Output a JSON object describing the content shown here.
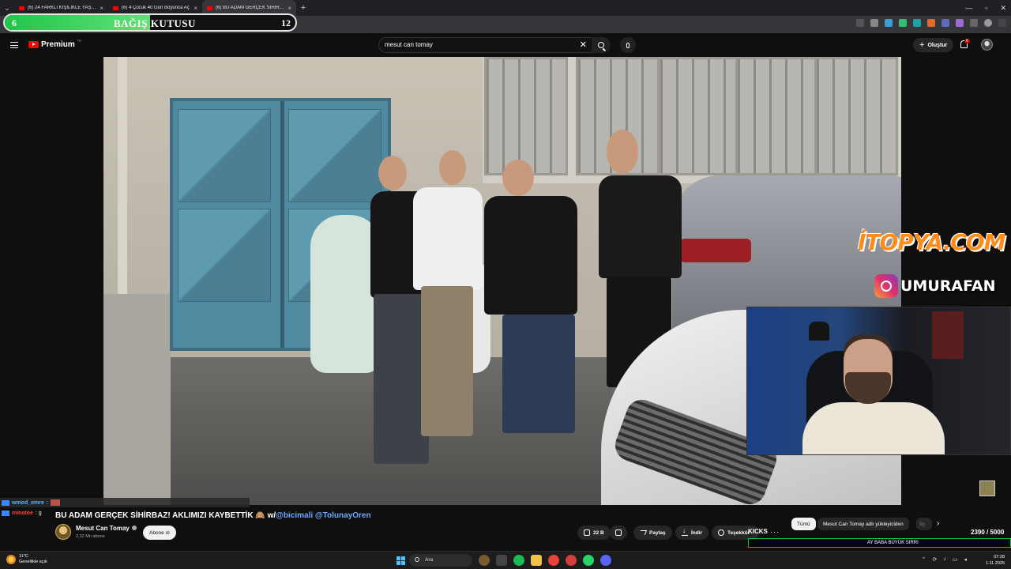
{
  "browser": {
    "tabs": [
      {
        "title": "(6) 24 FARKLI KİŞİLİKLE YAŞAYAN"
      },
      {
        "title": "(6) 4 Çocuk 40 Gün Boyunca Aç"
      },
      {
        "title": "(6) BU ADAM GERÇEK SİHİRBAZ"
      }
    ],
    "new_tab": "+",
    "active_tab_index": 2
  },
  "donation": {
    "current": "6",
    "label": "BAĞIŞ KUTUSU",
    "goal": "12",
    "progress": 0.5,
    "bar_color": "#21c548"
  },
  "youtube": {
    "logo_text": "Premium",
    "logo_region": "TR",
    "search": {
      "value": "mesut can tomay"
    },
    "create_label": "Oluştur",
    "notif_count": "6"
  },
  "overlay": {
    "sponsor": "İTOPYA.COM",
    "instagram": "UMURAFAN"
  },
  "chat": [
    {
      "user": "wmod_emre",
      "message": ":"
    },
    {
      "user": "minatoe",
      "message": ": g"
    }
  ],
  "video": {
    "title": "BU ADAM GERÇEK SİHİRBAZ! AKLIMIZI KAYBETTİK",
    "title_emoji": "🙈",
    "title_suffix": "w/",
    "mentions": "@bicimali @TolunayOren",
    "channel": "Mesut Can Tomay",
    "subs": "2,32 Mn abone",
    "subscribe_label": "Abone ol",
    "likes": "22 B",
    "share": "Paylaş",
    "download": "İndir",
    "thanks": "Teşekkür",
    "more": "···"
  },
  "stream": {
    "kicks_label": "KICKS",
    "counter": "2390 / 5000",
    "marquee": "AY BABA BÜYÜK SIRRI"
  },
  "chips": [
    {
      "label": "Tümü"
    },
    {
      "label": "Mesut Can Tomay adlı yükleyiciden"
    },
    {
      "label": "İlg"
    }
  ],
  "taskbar": {
    "temp": "11°C",
    "weather": "Genellikle açık",
    "search_label": "Ara",
    "time": "07:28",
    "date": "1.11.2025"
  },
  "colors": {
    "accent_blue": "#3ea6ff",
    "yt_red": "#ff0000",
    "sponsor_orange": "#ff8c1a",
    "marquee_border": "#1fbf3c"
  }
}
